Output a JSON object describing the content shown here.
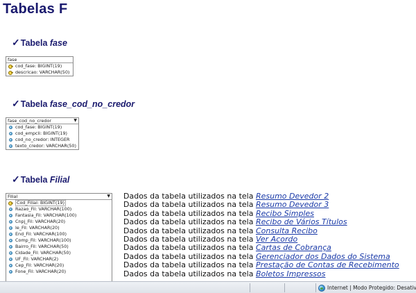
{
  "page": {
    "title": "Tabelas F"
  },
  "sections": [
    {
      "check": "✓",
      "prefix": "Tabela ",
      "name": "fase",
      "table_title": "fase",
      "columns": [
        {
          "icon": "key-icon",
          "label": "cod_fase: BIGINT(19)"
        },
        {
          "icon": "field-icon",
          "label": "descricao: VARCHAR(50)"
        }
      ]
    },
    {
      "check": "✓",
      "prefix": "Tabela ",
      "name": "fase_cod_no_credor",
      "table_title": "fase_cod_no_credor",
      "columns": [
        {
          "icon": "field-icon",
          "label": "cod_fase: BIGINT(19)"
        },
        {
          "icon": "field-icon",
          "label": "cod_empcli: BIGINT(19)"
        },
        {
          "icon": "field-icon",
          "label": "cod_no_credor: INTEGER"
        },
        {
          "icon": "field-icon",
          "label": "texto_credor: VARCHAR(50)"
        }
      ]
    },
    {
      "check": "✓",
      "prefix": "Tabela ",
      "name": "Filial",
      "table_title": "Filial",
      "columns": [
        {
          "icon": "key-icon",
          "label": "Cod_Filial: BIGINT(19)"
        },
        {
          "icon": "field-icon",
          "label": "Razao_Fil: VARCHAR(100)"
        },
        {
          "icon": "field-icon",
          "label": "Fantasia_Fil: VARCHAR(100)"
        },
        {
          "icon": "field-icon",
          "label": "Cnpj_Fil: VARCHAR(20)"
        },
        {
          "icon": "field-icon",
          "label": "Ie_Fil: VARCHAR(20)"
        },
        {
          "icon": "field-icon",
          "label": "End_Fil: VARCHAR(100)"
        },
        {
          "icon": "field-icon",
          "label": "Comp_Fil: VARCHAR(100)"
        },
        {
          "icon": "field-icon",
          "label": "Bairro_Fil: VARCHAR(50)"
        },
        {
          "icon": "field-icon",
          "label": "Cidade_Fil: VARCHAR(50)"
        },
        {
          "icon": "field-icon",
          "label": "UF_Fil: VARCHAR(2)"
        },
        {
          "icon": "field-icon",
          "label": "Cep_Fil: VARCHAR(20)"
        },
        {
          "icon": "field-icon",
          "label": "Fone_Fil: VARCHAR(20)"
        }
      ]
    }
  ],
  "usage": {
    "prefix": "Dados da tabela utilizados na tela ",
    "links": [
      "Resumo Devedor 2",
      "Resumo Devedor 3",
      "Recibo Simples",
      "Recibo de Vários Títulos",
      "Consulta Recibo",
      "Ver Acordo",
      "Cartas de Cobrança",
      "Gerenciador dos Dados do Sistema",
      "Prestação de Contas de Recebimento",
      "Boletos Impressos"
    ]
  },
  "statusbar": {
    "zone_text": "Internet | Modo Protegido: Desativado"
  }
}
